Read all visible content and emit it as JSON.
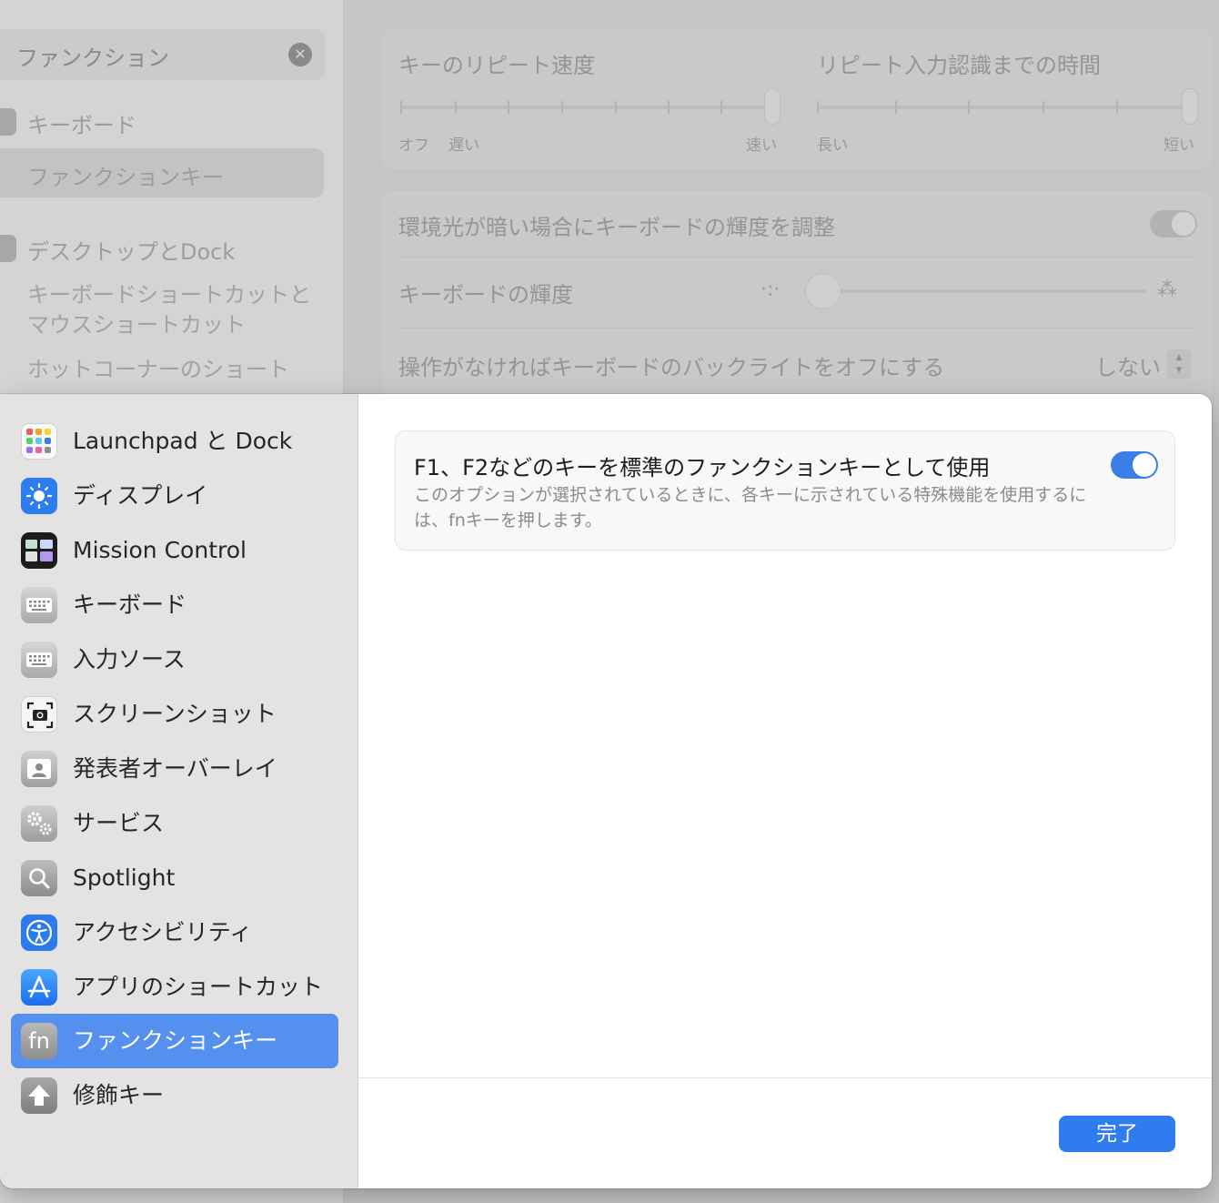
{
  "background": {
    "search": {
      "value": "ファンクション",
      "clear_icon": "x-circle-icon"
    },
    "sidebar": {
      "keyboard": "キーボード",
      "function_keys": "ファンクションキー",
      "desktop_dock": "デスクトップとDock",
      "kbd_mouse_shortcuts_1": "キーボードショートカットと",
      "kbd_mouse_shortcuts_2": "マウスショートカット",
      "hot_corners": "ホットコーナーのショート"
    },
    "repeat": {
      "key_repeat_label": "キーのリピート速度",
      "delay_label": "リピート入力認識までの時間",
      "off": "オフ",
      "slow": "遅い",
      "fast": "速い",
      "long": "長い",
      "short": "短い"
    },
    "lighting": {
      "auto_brightness": "環境光が暗い場合にキーボードの輝度を調整",
      "brightness": "キーボードの輝度",
      "backlight_off": "操作がなければキーボードのバックライトをオフにする",
      "backlight_value": "しない"
    }
  },
  "sheet": {
    "sidebar": [
      {
        "label": "Launchpad と Dock",
        "icon": "launchpad-icon"
      },
      {
        "label": "ディスプレイ",
        "icon": "display-icon"
      },
      {
        "label": "Mission Control",
        "icon": "mission-control-icon"
      },
      {
        "label": "キーボード",
        "icon": "keyboard-icon"
      },
      {
        "label": "入力ソース",
        "icon": "input-sources-icon"
      },
      {
        "label": "スクリーンショット",
        "icon": "screenshot-icon"
      },
      {
        "label": "発表者オーバーレイ",
        "icon": "presenter-overlay-icon"
      },
      {
        "label": "サービス",
        "icon": "services-icon"
      },
      {
        "label": "Spotlight",
        "icon": "spotlight-icon"
      },
      {
        "label": "アクセシビリティ",
        "icon": "accessibility-icon"
      },
      {
        "label": "アプリのショートカット",
        "icon": "app-shortcuts-icon"
      },
      {
        "label": "ファンクションキー",
        "icon": "fn-icon",
        "selected": true,
        "icon_text": "fn"
      },
      {
        "label": "修飾キー",
        "icon": "modifier-keys-icon"
      }
    ],
    "option": {
      "title": "F1、F2などのキーを標準のファンクションキーとして使用",
      "description": "このオプションが選択されているときに、各キーに示されている特殊機能を使用するには、fnキーを押します。",
      "enabled": true
    },
    "done_label": "完了"
  },
  "colors": {
    "accent": "#3a7fe8",
    "selected": "#5590ee"
  }
}
